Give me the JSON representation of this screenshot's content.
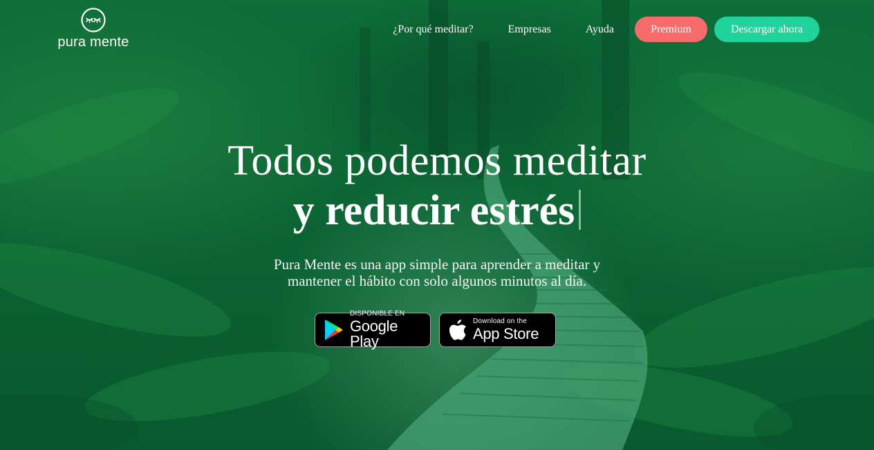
{
  "brand": {
    "name": "pura mente",
    "logo_icon": "closed-eyes-face-icon"
  },
  "nav": {
    "links": [
      {
        "label": "¿Por qué meditar?"
      },
      {
        "label": "Empresas"
      },
      {
        "label": "Ayuda"
      }
    ],
    "premium_label": "Premium",
    "download_label": "Descargar ahora"
  },
  "hero": {
    "title_line1": "Todos podemos meditar",
    "title_line2": "y reducir estrés",
    "subtitle_line1": "Pura Mente es una app simple para aprender a meditar y",
    "subtitle_line2": "mantener el hábito con solo algunos minutos al día."
  },
  "stores": {
    "google": {
      "small": "DISPONIBLE EN",
      "big": "Google Play",
      "icon": "google-play-icon"
    },
    "apple": {
      "small": "Download on the",
      "big": "App Store",
      "icon": "apple-icon"
    }
  },
  "colors": {
    "premium": "#f86b6b",
    "download": "#1fd39a",
    "background": "#0e5a2e"
  }
}
